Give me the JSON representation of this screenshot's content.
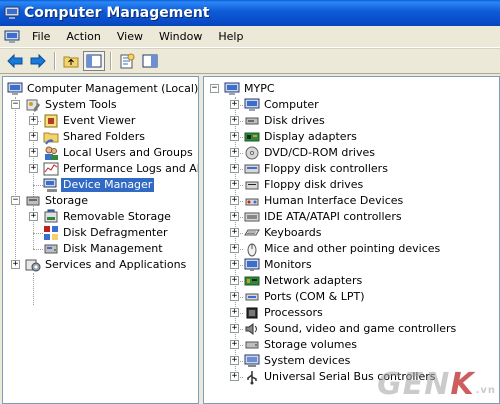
{
  "window": {
    "title": "Computer Management"
  },
  "menu": {
    "items": [
      "File",
      "Action",
      "View",
      "Window",
      "Help"
    ]
  },
  "left_tree": {
    "root": "Computer Management (Local)",
    "system_tools": "System Tools",
    "event_viewer": "Event Viewer",
    "shared_folders": "Shared Folders",
    "local_users": "Local Users and Groups",
    "perf_logs": "Performance Logs and Alerts",
    "device_manager": "Device Manager",
    "storage": "Storage",
    "removable_storage": "Removable Storage",
    "disk_defrag": "Disk Defragmenter",
    "disk_mgmt": "Disk Management",
    "services_apps": "Services and Applications",
    "selected": "Device Manager"
  },
  "right_tree": {
    "root": "MYPC",
    "items": [
      {
        "label": "Computer",
        "icon": "computer-icon"
      },
      {
        "label": "Disk drives",
        "icon": "disk-drive-icon"
      },
      {
        "label": "Display adapters",
        "icon": "display-adapter-icon"
      },
      {
        "label": "DVD/CD-ROM drives",
        "icon": "cdrom-icon"
      },
      {
        "label": "Floppy disk controllers",
        "icon": "floppy-controller-icon"
      },
      {
        "label": "Floppy disk drives",
        "icon": "floppy-drive-icon"
      },
      {
        "label": "Human Interface Devices",
        "icon": "hid-icon"
      },
      {
        "label": "IDE ATA/ATAPI controllers",
        "icon": "ide-controller-icon"
      },
      {
        "label": "Keyboards",
        "icon": "keyboard-icon"
      },
      {
        "label": "Mice and other pointing devices",
        "icon": "mouse-icon"
      },
      {
        "label": "Monitors",
        "icon": "monitor-icon"
      },
      {
        "label": "Network adapters",
        "icon": "network-adapter-icon"
      },
      {
        "label": "Ports (COM & LPT)",
        "icon": "port-icon"
      },
      {
        "label": "Processors",
        "icon": "processor-icon"
      },
      {
        "label": "Sound, video and game controllers",
        "icon": "sound-icon"
      },
      {
        "label": "Storage volumes",
        "icon": "storage-volume-icon"
      },
      {
        "label": "System devices",
        "icon": "system-device-icon"
      },
      {
        "label": "Universal Serial Bus controllers",
        "icon": "usb-icon"
      }
    ]
  },
  "watermark": {
    "text_a": "GEN",
    "text_b": "K",
    "text_c": ".vn"
  },
  "colors": {
    "selection": "#316ac5",
    "titlebar": "#0a5fd8"
  }
}
